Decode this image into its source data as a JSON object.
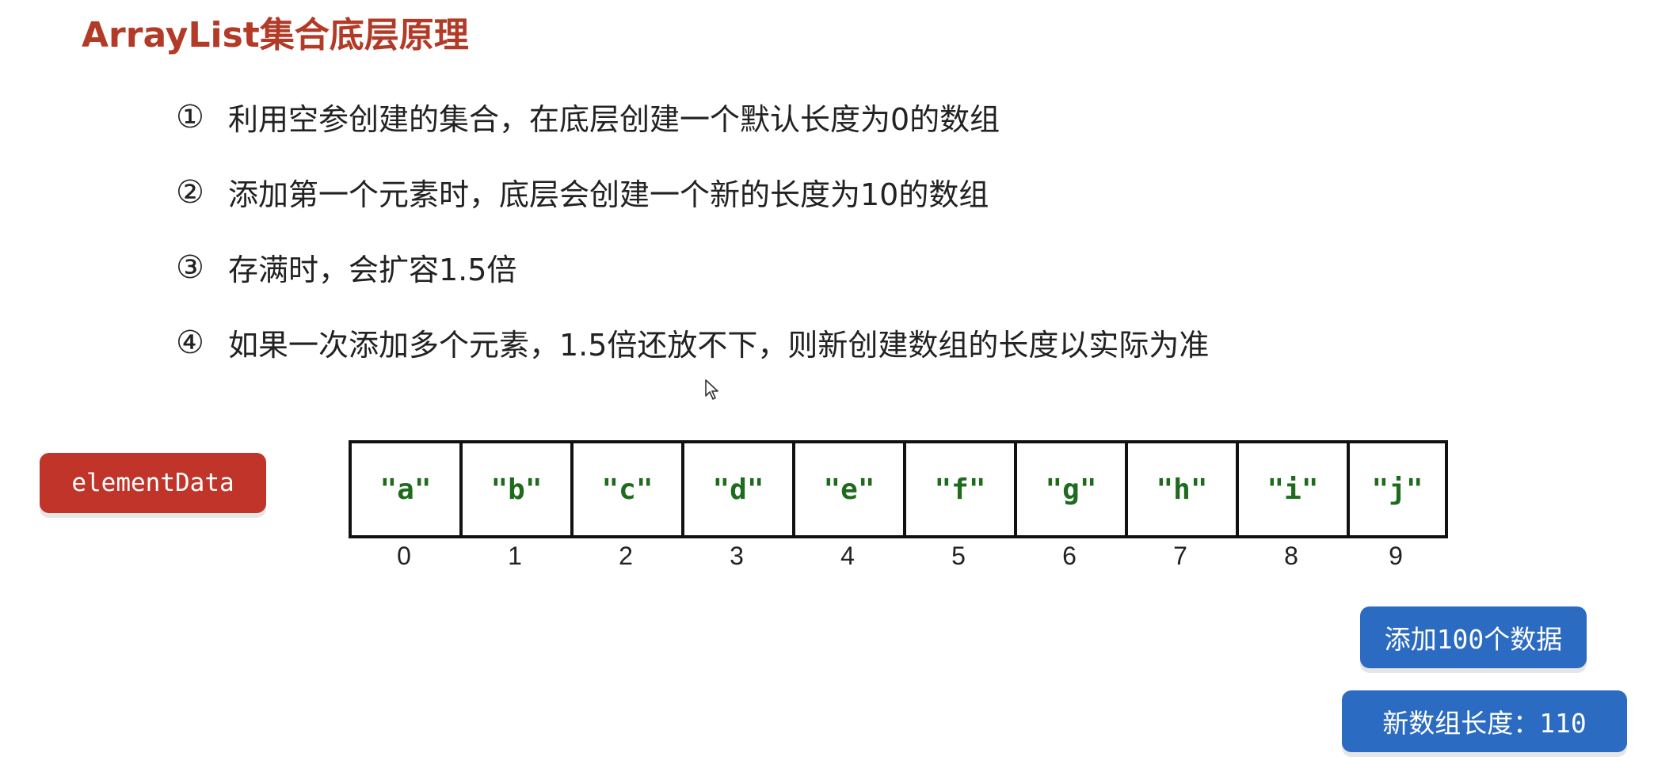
{
  "slide": {
    "title": "ArrayList集合底层原理"
  },
  "points": [
    {
      "marker": "①",
      "text": "利用空参创建的集合，在底层创建一个默认长度为0的数组"
    },
    {
      "marker": "②",
      "text": "添加第一个元素时，底层会创建一个新的长度为10的数组"
    },
    {
      "marker": "③",
      "text": "存满时，会扩容1.5倍"
    },
    {
      "marker": "④",
      "text": "如果一次添加多个元素，1.5倍还放不下，则新创建数组的长度以实际为准"
    }
  ],
  "diagram": {
    "variable_label": "elementData",
    "cells": [
      "\"a\"",
      "\"b\"",
      "\"c\"",
      "\"d\"",
      "\"e\"",
      "\"f\"",
      "\"g\"",
      "\"h\"",
      "\"i\"",
      "\"j\""
    ],
    "indices": [
      "0",
      "1",
      "2",
      "3",
      "4",
      "5",
      "6",
      "7",
      "8",
      "9"
    ]
  },
  "buttons": {
    "add_label": "添加100个数据",
    "new_length_label": "新数组长度：110"
  },
  "colors": {
    "title": "#b23a26",
    "variable_box": "#c1342a",
    "cell_text": "#1e6b1e",
    "button": "#2c6bc2"
  },
  "icons": {
    "cursor": "mouse-pointer-icon"
  }
}
